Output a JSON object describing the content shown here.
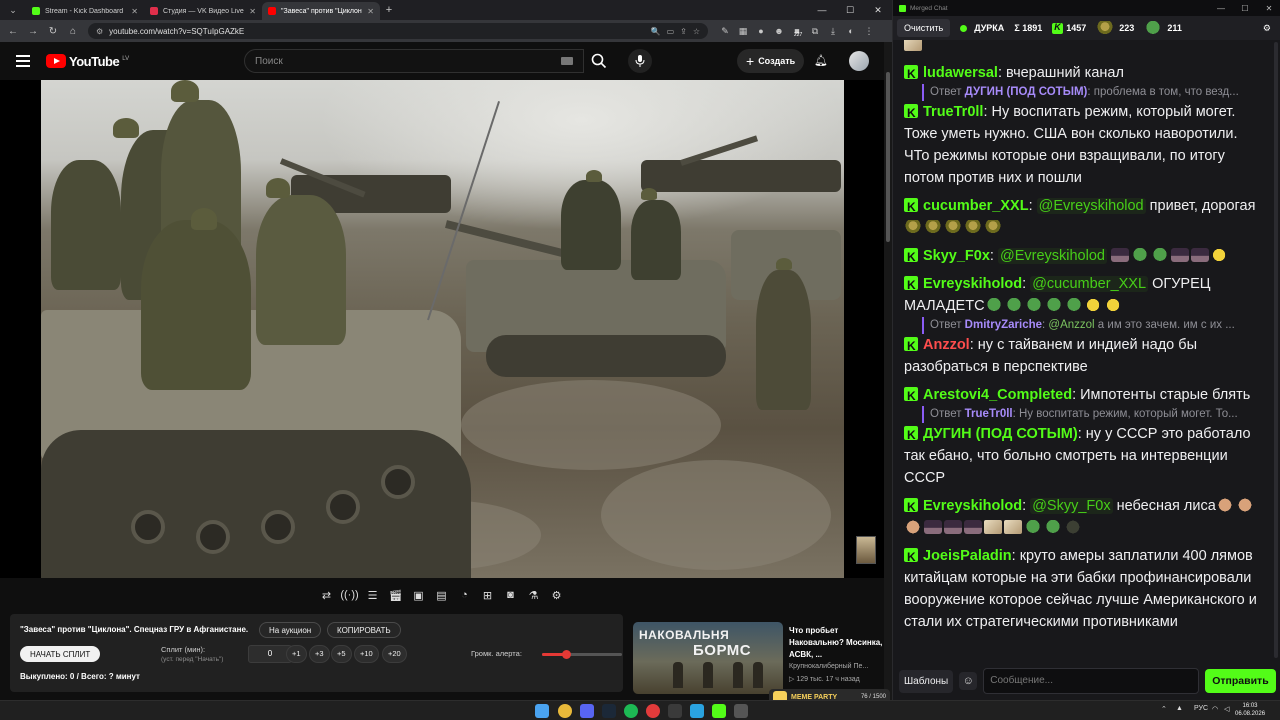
{
  "browser": {
    "tabs": [
      {
        "title": "Stream - Kick Dashboard",
        "favicon_color": "#53fc18"
      },
      {
        "title": "Студия — VK Видео Live",
        "favicon_color": "#e02f4b"
      },
      {
        "title": "\"Завеса\" против \"Циклона\". Сп...",
        "favicon_color": "#ff0000"
      }
    ],
    "address": "youtube.com/watch?v=SQTuIpGAZkE",
    "badge_count": "227"
  },
  "youtube": {
    "logo": "YouTube",
    "country": "LV",
    "search_placeholder": "Поиск",
    "create_label": "Создать"
  },
  "auction": {
    "title": "\"Завеса\" против \"Циклона\". Спецназ ГРУ в Афганистане.",
    "on_auction": "На аукцион",
    "copy": "КОПИРОВАТЬ",
    "start_split": "НАЧАТЬ СПЛИТ",
    "split_label": "Сплит (мин):",
    "split_hint": "(уст. перед \"Начать\")",
    "split_value": "0",
    "increments": [
      "+1",
      "+3",
      "+5",
      "+10",
      "+20"
    ],
    "volume_label": "Громк. алерта:",
    "volume_level": 0.3,
    "stats": "Выкуплено: 0 / Всего: ? минут"
  },
  "recommended": {
    "thumb_line1": "НАКОВАЛЬНЯ",
    "thumb_line2": "БОРМС",
    "title": "Что пробьет Наковальню? Мосинка, АСВК, ...",
    "channel": "Крупнокалиберный Пе...",
    "meta": "▷ 129 тыс.   17 ч назад"
  },
  "meme_party": {
    "label": "MEME PARTY",
    "count": "76 / 1500",
    "progress": 0.05
  },
  "chat": {
    "window_title": "Merged Chat",
    "clear": "Очистить",
    "channel": "ДУРКА",
    "sigma": "Σ 1891",
    "kick": "1457",
    "emote1": "223",
    "emote2": "211",
    "m1_user": "ludawersal",
    "m1_text": " вчерашний канал",
    "r1_prefix": "Ответ ",
    "r1_user": "ДУГИН (ПОД СОТЫМ)",
    "r1_text": ": проблема в том, что везд...",
    "m2_user": "TrueTr0ll",
    "m2_text": " Ну воспитать режим, который могет. Тоже уметь нужно. США вон сколько наворотили. ЧТо режимы которые они взращивали, по итогу потом против них и пошли",
    "m3_user": "cucumber_XXL",
    "m3_mention": "@Evreyskiholod",
    "m3_text": " привет, дорогая ",
    "m4_user": "Skyy_F0x",
    "m4_mention": "@Evreyskiholod",
    "m5_user": "Evreyskiholod",
    "m5_mention": "@cucumber_XXL",
    "m5_text": " ОГУРЕЦ МАЛАДЕТС",
    "r2_prefix": "Ответ ",
    "r2_user": "DmitryZariche",
    "r2_mention": "@Anzzol",
    "r2_text": " а им это зачем. им с их ...",
    "m6_user": "Anzzol",
    "m6_text": " ну с тайванем и индией надо бы разобраться в перспективе",
    "m7_user": "Arestovi4_Completed",
    "m7_text": " Импотенты старые блять",
    "r3_prefix": "Ответ ",
    "r3_user": "TrueTr0ll",
    "r3_text": ": Ну воспитать режим, который могет. То...",
    "m8_user": "ДУГИН (ПОД СОТЫМ)",
    "m8_text": " ну у СССР это работало так ебано, что больно смотреть на интервенции СССР",
    "m9_user": "Evreyskiholod",
    "m9_mention": "@Skyy_F0x",
    "m9_text": " небесная лиса",
    "m10_user": "JoeisPaladin",
    "m10_text": " круто амеры заплатили 400 лямов китайцам которые на эти бабки профинансировали вооружение которое сейчас лучше Американского и стали их стратегическими противниками",
    "templates": "Шаблоны",
    "input_placeholder": "Сообщение...",
    "send": "Отправить"
  },
  "taskbar": {
    "lang": "РУС",
    "time": "16:03",
    "date": "06.08.2026"
  }
}
